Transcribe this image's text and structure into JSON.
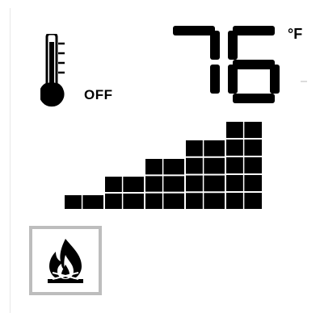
{
  "thermostat": {
    "mode": "OFF",
    "temperature": "76",
    "unit": "°F",
    "level": {
      "current": 5,
      "max": 5
    },
    "icons": {
      "thermometer": "thermometer-icon",
      "flame": "flame-icon"
    },
    "colors": {
      "segment": "#000000",
      "button_border": "#bdbdbd",
      "background": "#ffffff"
    }
  }
}
